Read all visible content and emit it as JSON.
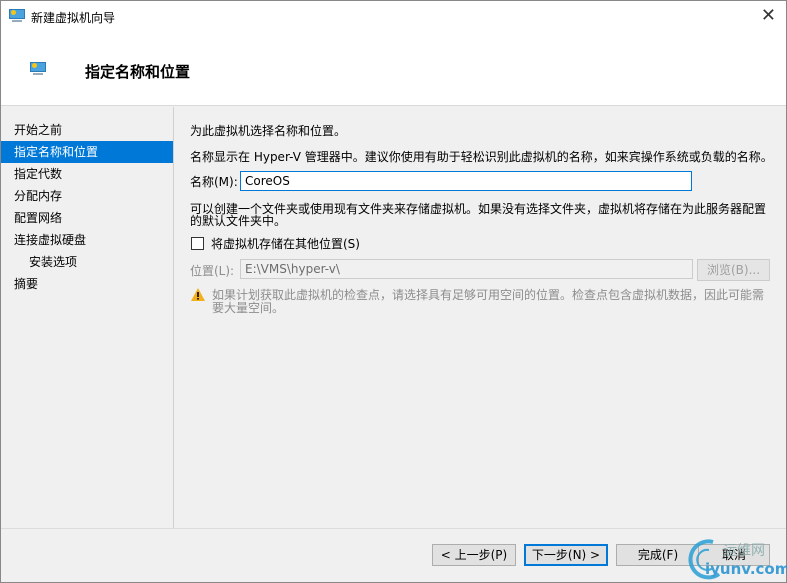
{
  "window": {
    "title": "新建虚拟机向导",
    "close_icon": "close-icon"
  },
  "header": {
    "title": "指定名称和位置",
    "icon": "virtual-machine-icon"
  },
  "nav": {
    "items": [
      {
        "label": "开始之前",
        "selected": false
      },
      {
        "label": "指定名称和位置",
        "selected": true
      },
      {
        "label": "指定代数",
        "selected": false
      },
      {
        "label": "分配内存",
        "selected": false
      },
      {
        "label": "配置网络",
        "selected": false
      },
      {
        "label": "连接虚拟硬盘",
        "selected": false
      },
      {
        "label": "安装选项",
        "selected": false
      },
      {
        "label": "摘要",
        "selected": false
      }
    ]
  },
  "content": {
    "intro": "为此虚拟机选择名称和位置。",
    "desc": "名称显示在 Hyper-V 管理器中。建议你使用有助于轻松识别此虚拟机的名称，如来宾操作系统或负载的名称。",
    "name_label": "名称(M):",
    "name_value": "CoreOS",
    "folder_desc_1": "可以创建一个文件夹或使用现有文件夹来存储虚拟机。如果没有选择文件夹，虚拟机将存储在为此服务器配置",
    "folder_desc_2": "的默认文件夹中。",
    "checkbox_label": "将虚拟机存储在其他位置(S)",
    "checkbox_checked": false,
    "location_label": "位置(L):",
    "location_value": "E:\\VMS\\hyper-v\\",
    "browse_label": "浏览(B)...",
    "warning_1": "如果计划获取此虚拟机的检查点，请选择具有足够可用空间的位置。检查点包含虚拟机数据，因此可能需",
    "warning_2": "要大量空间。"
  },
  "footer": {
    "prev": "< 上一步(P)",
    "next": "下一步(N) >",
    "finish": "完成(F)",
    "cancel": "取消"
  },
  "watermark": {
    "line1": "运维网",
    "line2": "iyunv.com"
  },
  "colors": {
    "selection": "#0078d7",
    "warning": "#f2b01e"
  }
}
